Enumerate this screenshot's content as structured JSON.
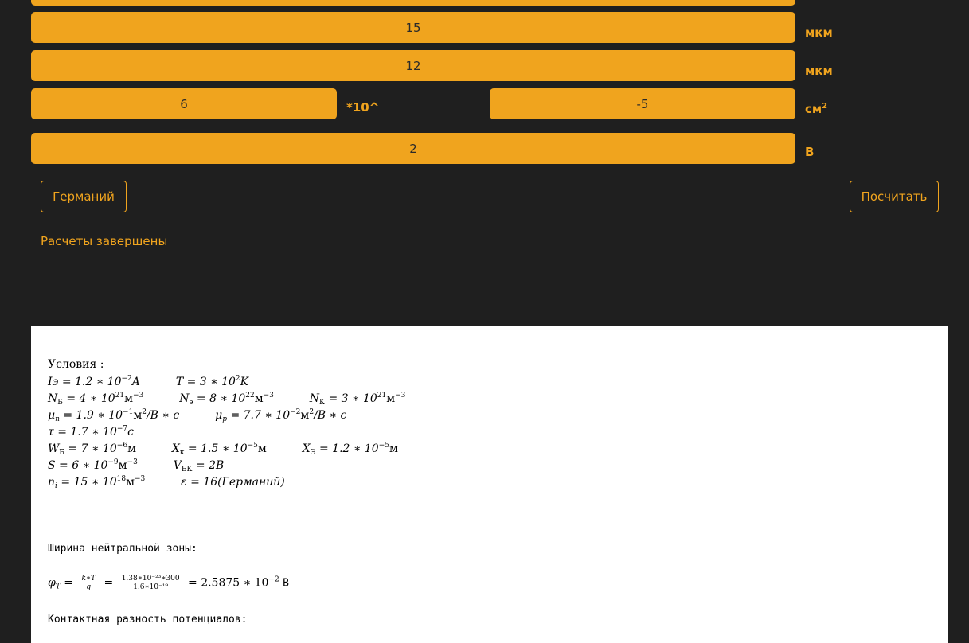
{
  "inputs": {
    "top_partial": "",
    "xk_value": "15",
    "xk_unit": "мкм",
    "xe_value": "12",
    "xe_unit": "мкм",
    "area_mantissa": "6",
    "times_ten": "*10^",
    "area_exponent": "-5",
    "area_unit": "см",
    "area_unit_sup": "2",
    "voltage_value": "2",
    "voltage_unit": "В"
  },
  "buttons": {
    "material": "Германий",
    "calculate": "Посчитать"
  },
  "status": "Расчеты завершены",
  "results": {
    "conditions_title": "Условия :",
    "l1": {
      "a": "Iэ = 1.2 ∗ 10",
      "a_sup": "−2",
      "a_end": "A",
      "b": "T = 3 ∗ 10",
      "b_sup": "2",
      "b_end": "K"
    },
    "l2": {
      "a": "N",
      "a_sub": "Б",
      "a_mid": " = 4 ∗ 10",
      "a_sup": "21",
      "a_end": "м",
      "a_sup2": "−3",
      "b": "N",
      "b_sub": "э",
      "b_mid": " = 8 ∗ 10",
      "b_sup": "22",
      "b_end": "м",
      "b_sup2": "−3",
      "c": "N",
      "c_sub": "К",
      "c_mid": " = 3 ∗ 10",
      "c_sup": "21",
      "c_end": "м",
      "c_sup2": "−3"
    },
    "l3": {
      "a": "μ",
      "a_sub": "n",
      "a_mid": " = 1.9 ∗ 10",
      "a_sup": "−1",
      "a_end": "м",
      "a_sup2": "2",
      "a_tail": "/B ∗ c",
      "b": "μ",
      "b_sub": "p",
      "b_mid": " = 7.7 ∗ 10",
      "b_sup": "−2",
      "b_end": "м",
      "b_sup2": "2",
      "b_tail": "/B ∗ c"
    },
    "l4": {
      "a": "τ = 1.7 ∗ 10",
      "a_sup": "−7",
      "a_end": "c"
    },
    "l5": {
      "a": "W",
      "a_sub": "Б",
      "a_mid": " = 7 ∗ 10",
      "a_sup": "−6",
      "a_end": "м",
      "b": "X",
      "b_sub": "к",
      "b_mid": " = 1.5 ∗ 10",
      "b_sup": "−5",
      "b_end": "м",
      "c": "X",
      "c_sub": "Э",
      "c_mid": " = 1.2 ∗ 10",
      "c_sup": "−5",
      "c_end": "м"
    },
    "l6": {
      "a": "S = 6 ∗ 10",
      "a_sup": "−9",
      "a_end": "м",
      "a_sup2": "−3",
      "b": "V",
      "b_sub": "БК",
      "b_mid": " = 2B"
    },
    "l7": {
      "a": "n",
      "a_sub": "i",
      "a_mid": " = 15 ∗ 10",
      "a_sup": "18",
      "a_end": "м",
      "a_sup2": "−3",
      "b": "ε = 16(Германий)"
    },
    "section1": "Ширина нейтральной зоны:",
    "phi": {
      "lhs": "φ",
      "lhs_sub": "T",
      "eq": " = ",
      "f1_num": "k∗T",
      "f1_den": "q",
      "f2_num": "1.38∗10⁻²³∗300",
      "f2_den": "1.6∗10⁻¹⁹",
      "res": " = 2.5875 ∗ 10",
      "res_sup": "−2",
      "unit": "В"
    },
    "section2": "Контактная разность потенциалов:"
  }
}
